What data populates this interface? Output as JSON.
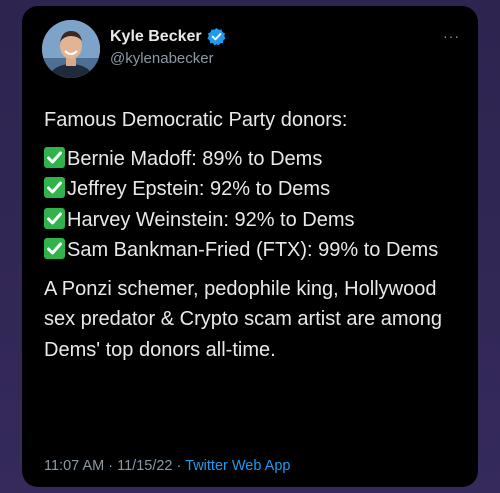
{
  "author": {
    "name": "Kyle Becker",
    "handle": "@kylenabecker",
    "verified": true
  },
  "icons": {
    "verified": "verified-badge-icon",
    "more": "more-options-icon",
    "check": "white-check-mark-icon"
  },
  "colors": {
    "background": "#000000",
    "text": "#e7e9ea",
    "secondary": "#8b98a5",
    "link": "#1d9bf0",
    "check_green": "#2fb34a"
  },
  "tweet": {
    "intro": "Famous Democratic Party donors:",
    "items": [
      "Bernie Madoff: 89% to Dems",
      "Jeffrey Epstein: 92% to Dems",
      "Harvey Weinstein: 92% to Dems",
      "Sam Bankman-Fried (FTX): 99% to Dems"
    ],
    "outro": "A Ponzi schemer, pedophile king, Hollywood sex predator & Crypto scam artist are among Dems' top donors all-time."
  },
  "meta": {
    "time": "11:07 AM",
    "separator": "·",
    "date": "11/15/22",
    "source": "Twitter Web App"
  },
  "more_label": "···"
}
